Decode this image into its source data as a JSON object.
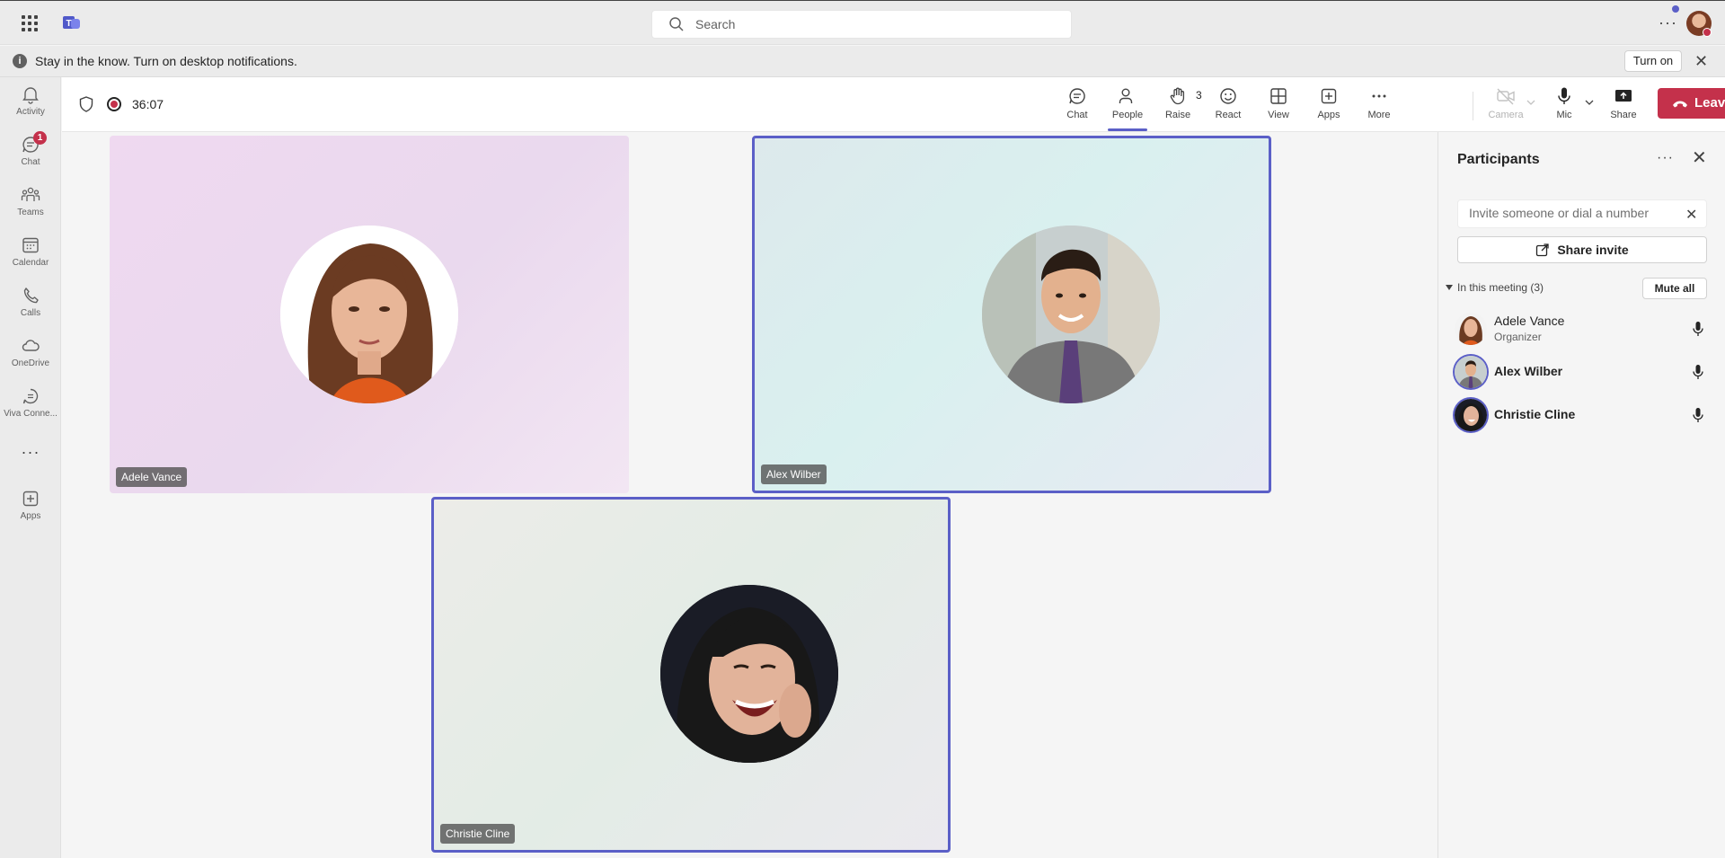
{
  "titlebar": {
    "search_placeholder": "Search",
    "more_label": "···"
  },
  "notification": {
    "message": "Stay in the know. Turn on desktop notifications.",
    "turn_on_label": "Turn on",
    "close_label": "✕"
  },
  "rail": {
    "items": [
      {
        "label": "Activity",
        "icon": "bell-icon"
      },
      {
        "label": "Chat",
        "icon": "chat-icon",
        "badge": "1"
      },
      {
        "label": "Teams",
        "icon": "teams-icon"
      },
      {
        "label": "Calendar",
        "icon": "calendar-icon"
      },
      {
        "label": "Calls",
        "icon": "phone-icon"
      },
      {
        "label": "OneDrive",
        "icon": "cloud-icon"
      },
      {
        "label": "Viva Conne...",
        "icon": "viva-icon"
      },
      {
        "label": "Apps",
        "icon": "plus-square-icon"
      }
    ],
    "more_label": "···"
  },
  "meeting": {
    "timer": "36:07",
    "people_count": "3",
    "toolbar": {
      "chat": "Chat",
      "people": "People",
      "raise": "Raise",
      "react": "React",
      "view": "View",
      "apps": "Apps",
      "more": "More",
      "camera": "Camera",
      "mic": "Mic",
      "share": "Share",
      "leave": "Leave"
    },
    "colors": {
      "accent": "#5b5fc7",
      "leave": "#c4314b"
    }
  },
  "tiles": [
    {
      "name": "Adele Vance",
      "speaking": false
    },
    {
      "name": "Alex Wilber",
      "speaking": true
    },
    {
      "name": "Christie Cline",
      "speaking": true
    }
  ],
  "participants_panel": {
    "title": "Participants",
    "more_label": "···",
    "close_label": "✕",
    "invite_placeholder": "Invite someone or dial a number",
    "share_invite_label": "Share invite",
    "section_label": "In this meeting (3)",
    "mute_all_label": "Mute all",
    "people": [
      {
        "name": "Adele Vance",
        "role": "Organizer"
      },
      {
        "name": "Alex Wilber",
        "role": ""
      },
      {
        "name": "Christie Cline",
        "role": ""
      }
    ]
  }
}
